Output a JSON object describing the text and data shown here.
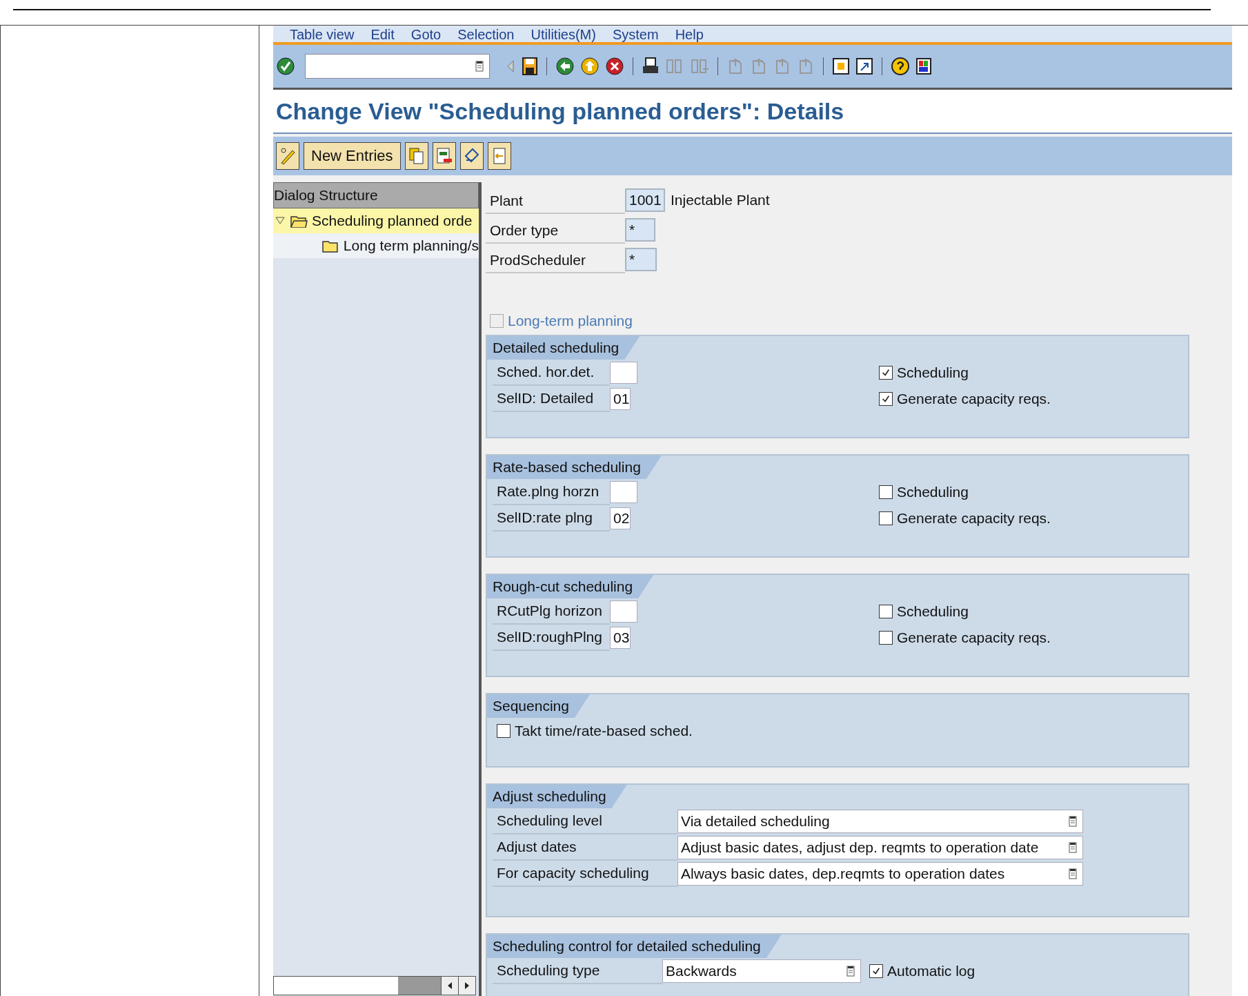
{
  "menu": [
    "Table view",
    "Edit",
    "Goto",
    "Selection",
    "Utilities(M)",
    "System",
    "Help"
  ],
  "title": "Change View \"Scheduling planned orders\": Details",
  "app_toolbar": {
    "new_entries": "New Entries"
  },
  "dialog_structure": {
    "title": "Dialog Structure",
    "items": [
      {
        "label": "Scheduling planned orde",
        "expanded": true,
        "selected": true,
        "children": [
          {
            "label": "Long term planning/s",
            "selected": false
          }
        ]
      }
    ]
  },
  "header_fields": [
    {
      "label": "Plant",
      "value": "1001",
      "description": "Injectable Plant"
    },
    {
      "label": "Order type",
      "value": "*"
    },
    {
      "label": "ProdScheduler",
      "value": "*"
    }
  ],
  "long_term_planning": {
    "label": "Long-term planning",
    "checked": false,
    "disabled": true
  },
  "groups": [
    {
      "kind": "horizon",
      "title": "Detailed scheduling",
      "fields": [
        {
          "label": "Sched. hor.det."
        },
        {
          "label": "SelID: Detailed",
          "value": "01"
        }
      ],
      "checks": [
        {
          "label": "Scheduling",
          "checked": true
        },
        {
          "label": "Generate capacity reqs.",
          "checked": true
        }
      ]
    },
    {
      "kind": "horizon",
      "title": "Rate-based scheduling",
      "fields": [
        {
          "label": "Rate.plng horzn"
        },
        {
          "label": "SelID:rate plng",
          "value": "02"
        }
      ],
      "checks": [
        {
          "label": "Scheduling",
          "checked": false
        },
        {
          "label": "Generate capacity reqs.",
          "checked": false
        }
      ]
    },
    {
      "kind": "horizon",
      "title": "Rough-cut scheduling",
      "fields": [
        {
          "label": "RCutPlg horizon"
        },
        {
          "label": "SelID:roughPlng",
          "value": "03"
        }
      ],
      "checks": [
        {
          "label": "Scheduling",
          "checked": false
        },
        {
          "label": "Generate capacity reqs.",
          "checked": false
        }
      ]
    },
    {
      "kind": "checkbox",
      "title": "Sequencing",
      "checks": [
        {
          "label": "Takt time/rate-based sched.",
          "checked": false
        }
      ]
    },
    {
      "kind": "dropdowns",
      "title": "Adjust scheduling",
      "fields": [
        {
          "label": "Scheduling level",
          "value": "Via detailed scheduling"
        },
        {
          "label": "Adjust dates",
          "value": "Adjust basic dates, adjust dep. reqmts to operation date"
        },
        {
          "label": "For capacity scheduling",
          "value": "Always basic dates, dep.reqmts to operation dates"
        }
      ]
    },
    {
      "kind": "control",
      "title": "Scheduling control for detailed scheduling",
      "fields": [
        {
          "label": "Scheduling type",
          "value": "Backwards"
        }
      ],
      "checks": [
        {
          "label": "Automatic log",
          "checked": true
        }
      ]
    }
  ]
}
